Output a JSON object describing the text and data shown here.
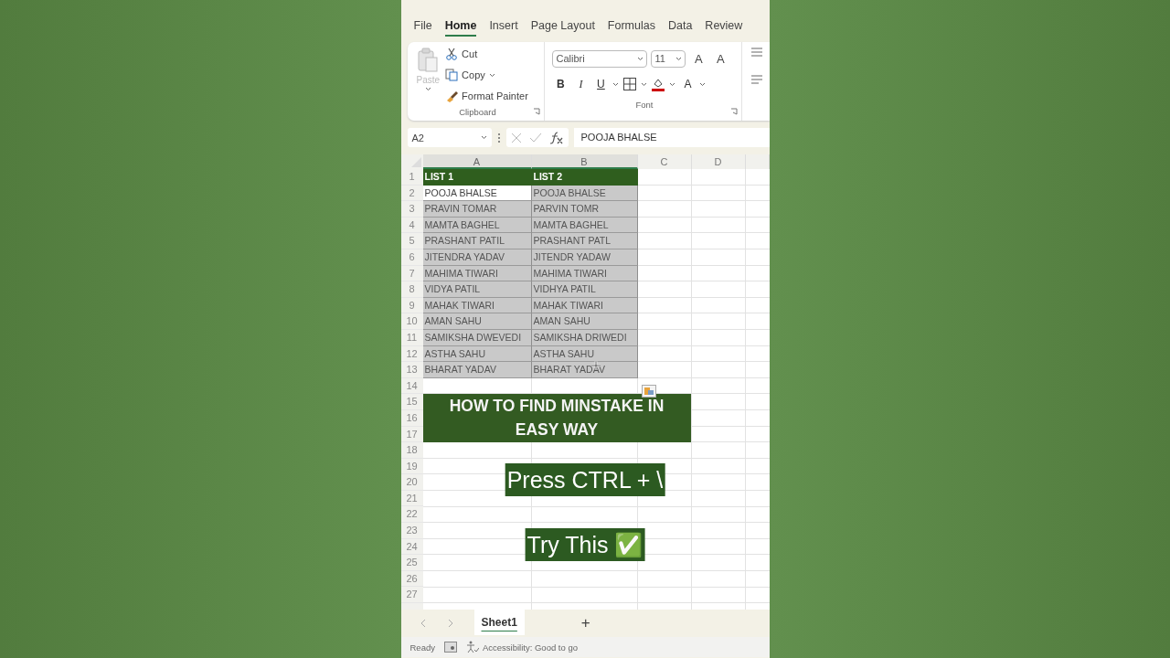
{
  "ribbon_tabs": [
    {
      "label": "File",
      "selected": false
    },
    {
      "label": "Home",
      "selected": true
    },
    {
      "label": "Insert",
      "selected": false
    },
    {
      "label": "Page Layout",
      "selected": false
    },
    {
      "label": "Formulas",
      "selected": false
    },
    {
      "label": "Data",
      "selected": false
    },
    {
      "label": "Review",
      "selected": false
    }
  ],
  "clipboard": {
    "paste": {
      "label": "Paste",
      "disabled": true
    },
    "items": [
      "Cut",
      "Copy",
      "Format Painter"
    ],
    "group_label": "Clipboard"
  },
  "font": {
    "name": "Calibri",
    "size": "11",
    "grow_shrink": [
      "A",
      "A"
    ],
    "format_buttons": [
      "B",
      "I",
      "U"
    ],
    "font_color": "A",
    "group_label": "Font"
  },
  "formula_bar": {
    "name_box": "A2",
    "value": "POOJA BHALSE"
  },
  "columns": [
    "A",
    "B",
    "C",
    "D"
  ],
  "rows": [
    {
      "number": "1",
      "cells": [
        {
          "text": "LIST 1",
          "kind": "header"
        },
        {
          "text": "LIST 2",
          "kind": "header"
        }
      ]
    },
    {
      "number": "2",
      "cells": [
        {
          "text": "POOJA BHALSE",
          "kind": "data",
          "active": true
        },
        {
          "text": "POOJA BHALSE",
          "kind": "data",
          "active": false
        }
      ]
    },
    {
      "number": "3",
      "cells": [
        {
          "text": "PRAVIN TOMAR",
          "kind": "data",
          "active": false
        },
        {
          "text": "PARVIN TOMR",
          "kind": "data",
          "active": false
        }
      ]
    },
    {
      "number": "4",
      "cells": [
        {
          "text": "MAMTA BAGHEL",
          "kind": "data",
          "active": false
        },
        {
          "text": "MAMTA BAGHEL",
          "kind": "data",
          "active": false
        }
      ]
    },
    {
      "number": "5",
      "cells": [
        {
          "text": "PRASHANT PATIL",
          "kind": "data",
          "active": false
        },
        {
          "text": "PRASHANT PATL",
          "kind": "data",
          "active": false
        }
      ]
    },
    {
      "number": "6",
      "cells": [
        {
          "text": "JITENDRA YADAV",
          "kind": "data",
          "active": false
        },
        {
          "text": "JITENDR YADAW",
          "kind": "data",
          "active": false
        }
      ]
    },
    {
      "number": "7",
      "cells": [
        {
          "text": "MAHIMA TIWARI",
          "kind": "data",
          "active": false
        },
        {
          "text": "MAHIMA TIWARI",
          "kind": "data",
          "active": false
        }
      ]
    },
    {
      "number": "8",
      "cells": [
        {
          "text": "VIDYA PATIL",
          "kind": "data",
          "active": false
        },
        {
          "text": "VIDHYA PATIL",
          "kind": "data",
          "active": false
        }
      ]
    },
    {
      "number": "9",
      "cells": [
        {
          "text": "MAHAK TIWARI",
          "kind": "data",
          "active": false
        },
        {
          "text": "MAHAK TIWARI",
          "kind": "data",
          "active": false
        }
      ]
    },
    {
      "number": "10",
      "cells": [
        {
          "text": "AMAN SAHU",
          "kind": "data",
          "active": false
        },
        {
          "text": "AMAN SAHU",
          "kind": "data",
          "active": false
        }
      ]
    },
    {
      "number": "11",
      "cells": [
        {
          "text": "SAMIKSHA DWEVEDI",
          "kind": "data",
          "active": false
        },
        {
          "text": "SAMIKSHA DRIWEDI",
          "kind": "data",
          "active": false
        }
      ]
    },
    {
      "number": "12",
      "cells": [
        {
          "text": "ASTHA SAHU",
          "kind": "data",
          "active": false
        },
        {
          "text": "ASTHA SAHU",
          "kind": "data",
          "active": false
        }
      ]
    },
    {
      "number": "13",
      "cells": [
        {
          "text": "BHARAT YADAV",
          "kind": "data",
          "active": false
        },
        {
          "text": "BHARAT YADAV",
          "kind": "data",
          "active": false
        }
      ]
    },
    {
      "number": "14"
    },
    {
      "number": "15"
    },
    {
      "number": "16"
    },
    {
      "number": "17"
    },
    {
      "number": "18"
    },
    {
      "number": "19"
    },
    {
      "number": "20"
    },
    {
      "number": "21"
    },
    {
      "number": "22"
    },
    {
      "number": "23"
    },
    {
      "number": "24"
    },
    {
      "number": "25"
    },
    {
      "number": "26"
    },
    {
      "number": "27"
    }
  ],
  "banner": "HOW TO FIND MINSTAKE IN EASY WAY",
  "captions": [
    "Press CTRL + \\",
    "Try This ✅"
  ],
  "sheet_tabs": [
    {
      "label": "Sheet1",
      "selected": true
    }
  ],
  "add_sheet": "+",
  "status_bar": {
    "mode": "Ready",
    "accessibility": "Accessibility: Good to go"
  }
}
